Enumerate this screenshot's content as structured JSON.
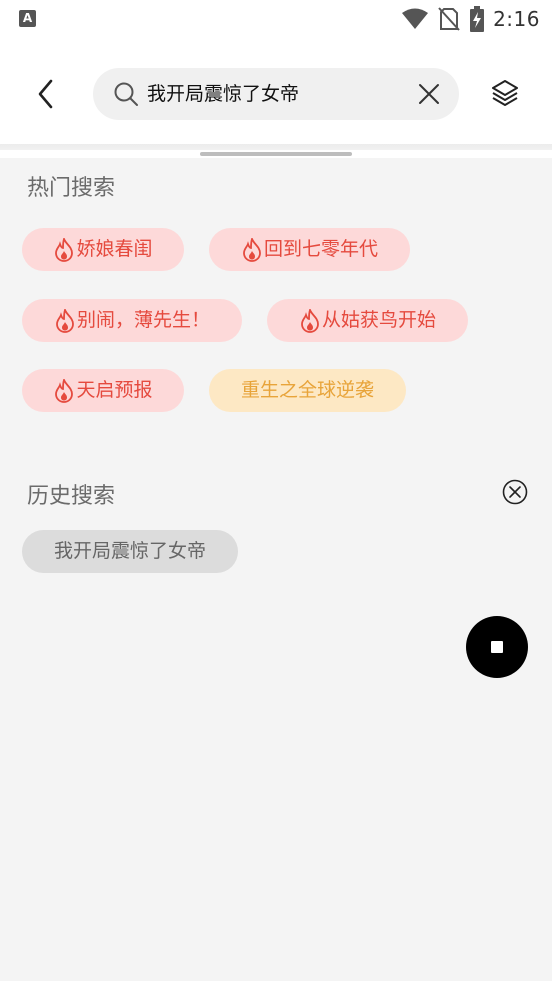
{
  "status_bar": {
    "app_icon_letter": "A",
    "time": "2:16"
  },
  "header": {
    "search_value": "我开局震惊了女帝"
  },
  "hot_search": {
    "title": "热门搜索",
    "tags": [
      {
        "label": "娇娘春闺",
        "style": "hot",
        "icon": "flame-icon"
      },
      {
        "label": "回到七零年代",
        "style": "hot",
        "icon": "flame-icon"
      },
      {
        "label": "别闹，薄先生！",
        "style": "hot",
        "icon": "flame-icon"
      },
      {
        "label": "从姑获鸟开始",
        "style": "hot",
        "icon": "flame-icon"
      },
      {
        "label": "天启预报",
        "style": "hot",
        "icon": "flame-icon"
      },
      {
        "label": "重生之全球逆袭",
        "style": "new",
        "icon": null
      }
    ]
  },
  "history_search": {
    "title": "历史搜索",
    "items": [
      {
        "label": "我开局震惊了女帝"
      }
    ]
  },
  "colors": {
    "hot_tag_bg": "#fdd9d9",
    "hot_tag_text": "#e54a3e",
    "new_tag_bg": "#fde8c4",
    "new_tag_text": "#e8a43a",
    "history_tag_bg": "#dcdcdc"
  }
}
